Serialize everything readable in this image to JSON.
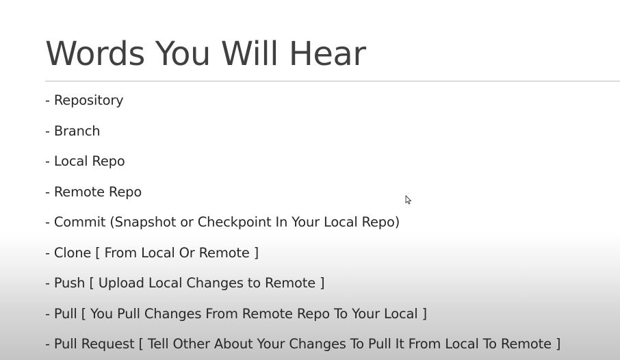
{
  "slide": {
    "title": "Words You Will Hear",
    "bullets": [
      "- Repository",
      "- Branch",
      "- Local Repo",
      "- Remote Repo",
      "- Commit (Snapshot or Checkpoint In Your Local Repo)",
      "- Clone [ From Local Or Remote ]",
      "- Push [ Upload Local Changes to Remote ]",
      "- Pull [ You Pull Changes From Remote Repo To Your Local ]",
      "- Pull Request [ Tell Other About Your Changes To Pull It From Local To Remote ]"
    ]
  },
  "icons": {
    "cursor": "mouse-pointer-icon"
  },
  "colors": {
    "title": "#404040",
    "text": "#262626",
    "rule": "#bdbdbd",
    "background_top": "#ffffff",
    "background_bottom": "#c4c4c4"
  }
}
